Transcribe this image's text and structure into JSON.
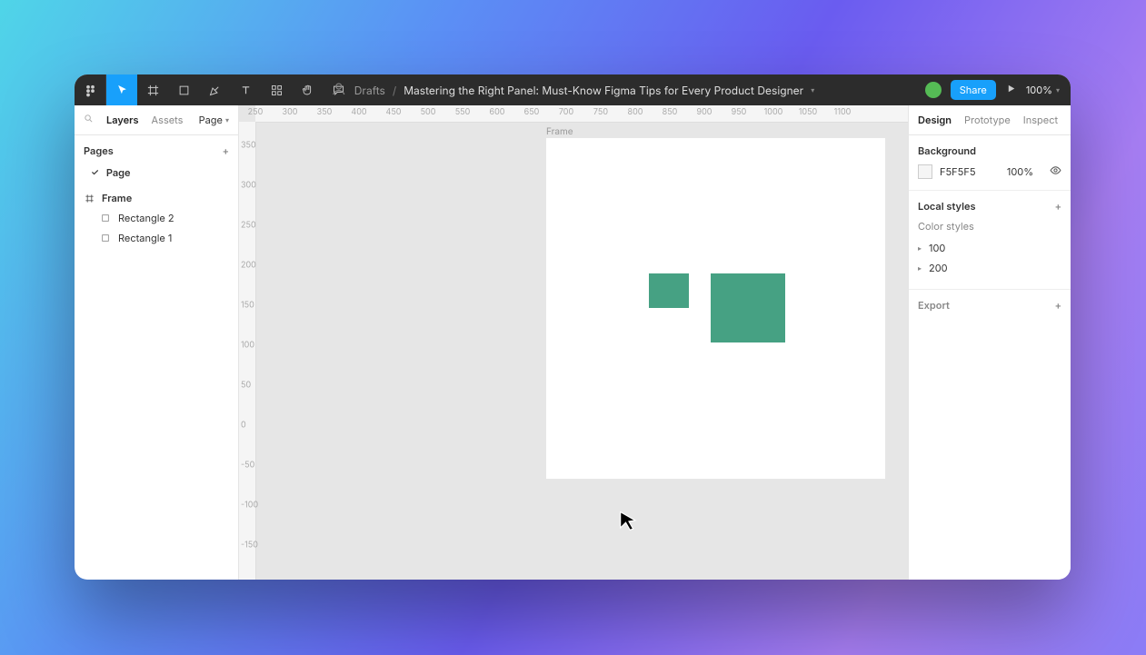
{
  "toolbar": {
    "breadcrumb_location": "Drafts",
    "breadcrumb_title": "Mastering the Right Panel: Must-Know Figma Tips for Every Product Designer",
    "share_label": "Share",
    "zoom": "100%"
  },
  "left_panel": {
    "tabs": {
      "layers": "Layers",
      "assets": "Assets"
    },
    "page_selector": "Page",
    "pages_header": "Pages",
    "pages": [
      {
        "label": "Page",
        "active": true
      }
    ],
    "layers": [
      {
        "label": "Frame",
        "type": "frame",
        "depth": 0,
        "bold": true
      },
      {
        "label": "Rectangle 2",
        "type": "rect",
        "depth": 1
      },
      {
        "label": "Rectangle 1",
        "type": "rect",
        "depth": 1
      }
    ]
  },
  "canvas": {
    "frame_label": "Frame",
    "ruler_h": [
      "250",
      "300",
      "350",
      "400",
      "450",
      "500",
      "550",
      "600",
      "650",
      "700",
      "750",
      "800",
      "850",
      "900",
      "950",
      "1000",
      "1050",
      "1100"
    ],
    "ruler_v": [
      "350",
      "300",
      "250",
      "200",
      "150",
      "100",
      "50",
      "0",
      "-50",
      "-100",
      "-150"
    ]
  },
  "right_panel": {
    "tabs": {
      "design": "Design",
      "prototype": "Prototype",
      "inspect": "Inspect"
    },
    "background": {
      "header": "Background",
      "hex": "F5F5F5",
      "opacity": "100%"
    },
    "local_styles": {
      "header": "Local styles",
      "subheader": "Color styles",
      "items": [
        "100",
        "200"
      ]
    },
    "export": {
      "header": "Export"
    }
  }
}
